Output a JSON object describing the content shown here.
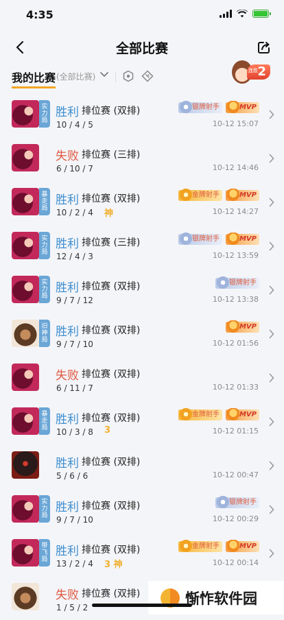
{
  "status_bar": {
    "time": "4:35"
  },
  "nav": {
    "title": "全部比赛"
  },
  "filter": {
    "title": "我的比赛",
    "subtitle": "(全部比赛)",
    "mascot_badge": "2",
    "mascot_small": "连胜"
  },
  "matches": [
    {
      "avatar": "hero-pink",
      "tag": "实力局",
      "result": "胜利",
      "outcome": "win",
      "mode": "排位赛 (双排)",
      "kda": "10 / 4 / 5",
      "honor": "",
      "badges": [
        "银牌射手",
        "MVP"
      ],
      "badge_types": [
        "silver",
        "mvp"
      ],
      "time": "10-12 15:07"
    },
    {
      "avatar": "hero-pink",
      "tag": "",
      "result": "失败",
      "outcome": "lose",
      "mode": "排位赛 (三排)",
      "kda": "6 / 10 / 7",
      "honor": "",
      "badges": [],
      "badge_types": [],
      "time": "10-12 14:46"
    },
    {
      "avatar": "hero-pink",
      "tag": "暴走局",
      "result": "胜利",
      "outcome": "win",
      "mode": "排位赛 (双排)",
      "kda": "10 / 2 / 4",
      "honor": "神",
      "badges": [
        "金牌射手",
        "MVP"
      ],
      "badge_types": [
        "gold",
        "mvp"
      ],
      "time": "10-12 14:27"
    },
    {
      "avatar": "hero-pink",
      "tag": "实力局",
      "result": "胜利",
      "outcome": "win",
      "mode": "排位赛 (三排)",
      "kda": "12 / 4 / 3",
      "honor": "",
      "badges": [
        "银牌射手",
        "MVP"
      ],
      "badge_types": [
        "silver",
        "mvp"
      ],
      "time": "10-12 13:59"
    },
    {
      "avatar": "hero-pink",
      "tag": "实力局",
      "result": "胜利",
      "outcome": "win",
      "mode": "排位赛 (双排)",
      "kda": "9 / 7 / 12",
      "honor": "",
      "badges": [
        "银牌射手"
      ],
      "badge_types": [
        "silver"
      ],
      "time": "10-12 13:38"
    },
    {
      "avatar": "hero-monk",
      "tag": "旧神局",
      "result": "胜利",
      "outcome": "win",
      "mode": "排位赛 (双排)",
      "kda": "9 / 7 / 10",
      "honor": "",
      "badges": [
        "MVP"
      ],
      "badge_types": [
        "mvp"
      ],
      "time": "10-12 01:56"
    },
    {
      "avatar": "hero-pink",
      "tag": "",
      "result": "失败",
      "outcome": "lose",
      "mode": "排位赛 (双排)",
      "kda": "6 / 11 / 7",
      "honor": "",
      "badges": [],
      "badge_types": [],
      "time": "10-12 01:33"
    },
    {
      "avatar": "hero-pink",
      "tag": "暴走局",
      "result": "胜利",
      "outcome": "win",
      "mode": "排位赛 (双排)",
      "kda": "10 / 3 / 8",
      "honor": "3",
      "badges": [
        "金牌射手",
        "MVP"
      ],
      "badge_types": [
        "gold",
        "mvp"
      ],
      "time": "10-12 01:15"
    },
    {
      "avatar": "hero-dark",
      "tag": "",
      "result": "胜利",
      "outcome": "win",
      "mode": "排位赛 (双排)",
      "kda": "5 / 6 / 6",
      "honor": "",
      "badges": [],
      "badge_types": [],
      "time": "10-12 00:47"
    },
    {
      "avatar": "hero-pink",
      "tag": "实力局",
      "result": "胜利",
      "outcome": "win",
      "mode": "排位赛 (双排)",
      "kda": "9 / 7 / 10",
      "honor": "",
      "badges": [
        "银牌射手"
      ],
      "badge_types": [
        "silver"
      ],
      "time": "10-12 00:29"
    },
    {
      "avatar": "hero-pink",
      "tag": "带飞局",
      "result": "胜利",
      "outcome": "win",
      "mode": "排位赛 (双排)",
      "kda": "13 / 2 / 4",
      "honor": "3 神",
      "badges": [
        "金牌射手",
        "MVP"
      ],
      "badge_types": [
        "gold",
        "mvp"
      ],
      "time": "10-12 00:14"
    },
    {
      "avatar": "hero-monk",
      "tag": "",
      "result": "失败",
      "outcome": "lose",
      "mode": "排位赛 (双排)",
      "kda": "1 / 5 / 2",
      "honor": "",
      "badges": [],
      "badge_types": [],
      "time": ""
    }
  ],
  "watermark": {
    "text": "惭怍软件园"
  }
}
